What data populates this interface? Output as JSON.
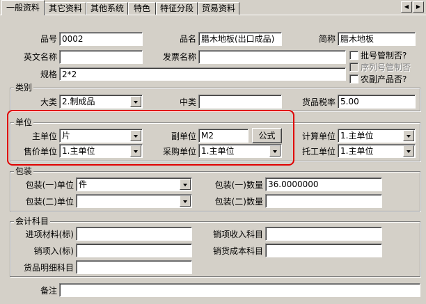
{
  "tabs": [
    {
      "label": "一般资料",
      "active": true
    },
    {
      "label": "其它资料"
    },
    {
      "label": "其他系统"
    },
    {
      "label": "特色"
    },
    {
      "label": "特征分段"
    },
    {
      "label": "贸易资料"
    }
  ],
  "basic": {
    "item_no_label": "品号",
    "item_no": "0002",
    "name_label": "品名",
    "name": "腊木地板(出口成品)",
    "short_name_label": "简称",
    "short_name": "腊木地板",
    "en_name_label": "英文名称",
    "en_name": "",
    "invoice_name_label": "发票名称",
    "invoice_name": "",
    "spec_label": "规格",
    "spec": "2*2"
  },
  "checks": {
    "batch_label": "批号管制否?",
    "serial_label": "序列号管制否",
    "farm_label": "农副产品否?"
  },
  "category": {
    "title": "类别",
    "major_label": "大类",
    "major": "2.制成品",
    "middle_label": "中类",
    "middle": "",
    "tax_label": "货品税率",
    "tax": "5.00"
  },
  "unit": {
    "title": "单位",
    "main_label": "主单位",
    "main": "片",
    "sub_label": "副单位",
    "sub": "M2",
    "formula_label": "公式",
    "calc_label": "计算单位",
    "calc": "1.主单位",
    "sale_label": "售价单位",
    "sale": "1.主单位",
    "purchase_label": "采购单位",
    "purchase": "1.主单位",
    "outsource_label": "托工单位",
    "outsource": "1.主单位"
  },
  "packing": {
    "title": "包装",
    "pack1_unit_label": "包装(一)单位",
    "pack1_unit": "件",
    "pack1_qty_label": "包装(一)数量",
    "pack1_qty": "36.0000000",
    "pack2_unit_label": "包装(二)单位",
    "pack2_unit": "",
    "pack2_qty_label": "包装(二)数量",
    "pack2_qty": ""
  },
  "accounting": {
    "title": "会计科目",
    "in_material_label": "进项材料(标)",
    "in_material": "",
    "sales_income_label": "销项收入科目",
    "sales_income": "",
    "sales_in_label": "销项入(标)",
    "sales_in": "",
    "sales_cost_label": "销货成本科目",
    "sales_cost": "",
    "detail_label": "货品明细科目",
    "detail": ""
  },
  "remark": {
    "label": "备注",
    "value": ""
  }
}
